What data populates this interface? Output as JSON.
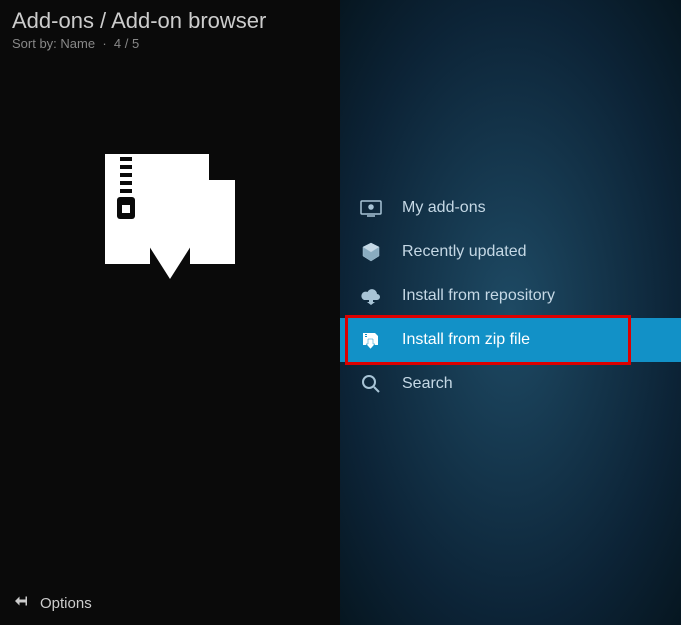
{
  "header": {
    "breadcrumb": "Add-ons / Add-on browser",
    "sort_label": "Sort by: Name",
    "position": "4 / 5"
  },
  "menu": {
    "items": [
      {
        "label": "My add-ons",
        "icon": "addons-icon",
        "selected": false
      },
      {
        "label": "Recently updated",
        "icon": "box-icon",
        "selected": false
      },
      {
        "label": "Install from repository",
        "icon": "cloud-download-icon",
        "selected": false
      },
      {
        "label": "Install from zip file",
        "icon": "zip-download-icon",
        "selected": true
      },
      {
        "label": "Search",
        "icon": "search-icon",
        "selected": false
      }
    ]
  },
  "footer": {
    "options": "Options"
  }
}
